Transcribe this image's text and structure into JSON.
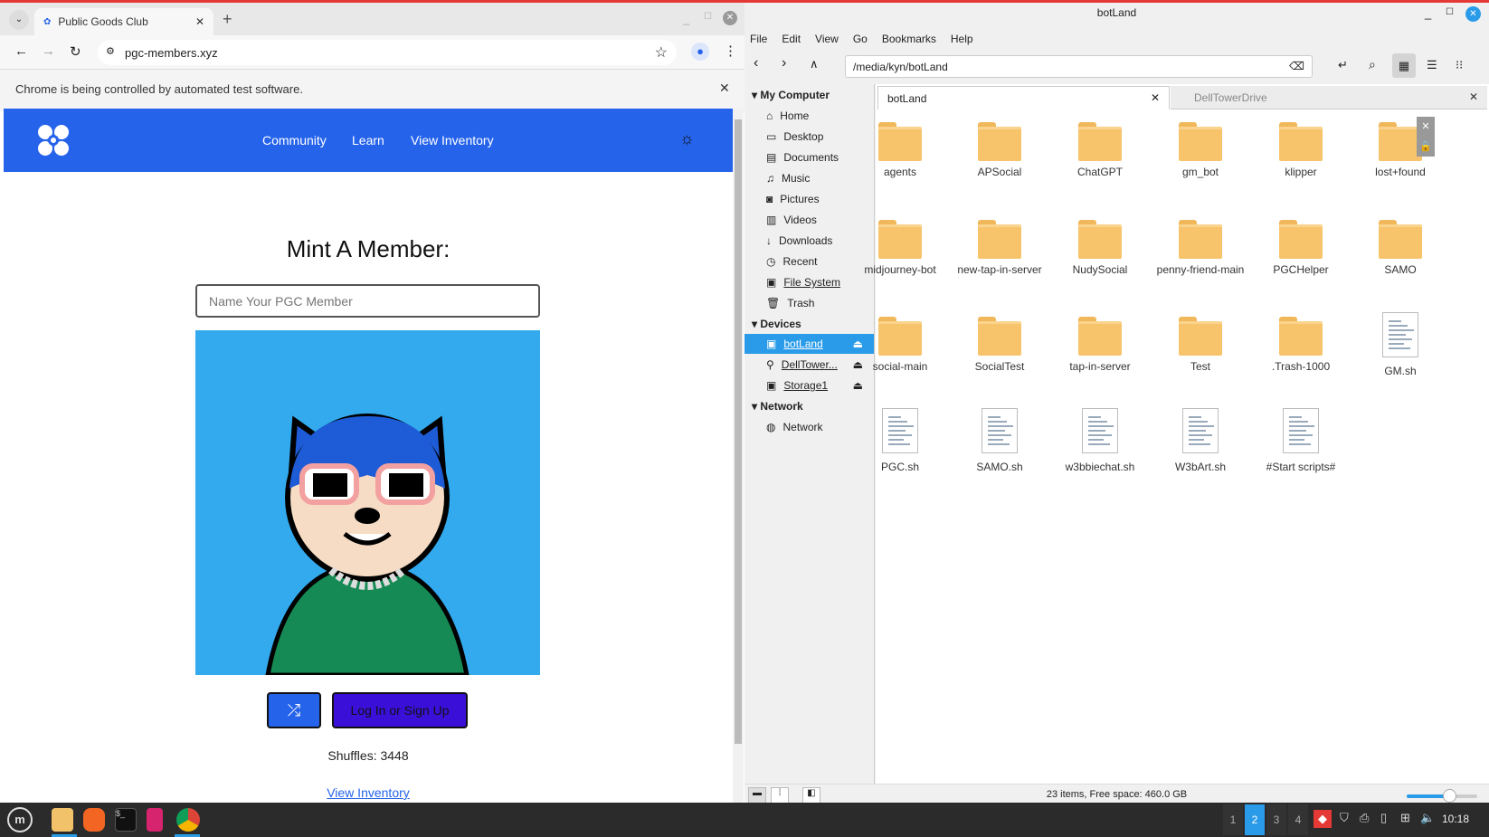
{
  "browser": {
    "tab_title": "Public Goods Club",
    "url": "pgc-members.xyz",
    "infobar": "Chrome is being controlled by automated test software."
  },
  "site": {
    "nav": [
      "Community",
      "Learn",
      "View Inventory"
    ],
    "heading": "Mint A Member:",
    "name_placeholder": "Name Your PGC Member",
    "login_label": "Log In or Sign Up",
    "shuffles": "Shuffles: 3448",
    "inventory_link": "View Inventory",
    "accent": "#2563eb",
    "image_bg": "#33aaee"
  },
  "fm": {
    "title": "botLand",
    "menu": [
      "File",
      "Edit",
      "View",
      "Go",
      "Bookmarks",
      "Help"
    ],
    "path": "/media/kyn/botLand",
    "tabs": [
      "botLand",
      "DellTowerDrive"
    ],
    "sections": {
      "my_computer": "My Computer",
      "devices": "Devices",
      "network": "Network"
    },
    "places": [
      "Home",
      "Desktop",
      "Documents",
      "Music",
      "Pictures",
      "Videos",
      "Downloads",
      "Recent",
      "File System",
      "Trash"
    ],
    "devices": [
      "botLand",
      "DellTower...",
      "Storage1"
    ],
    "network_items": [
      "Network"
    ],
    "items": [
      {
        "name": "agents",
        "type": "folder"
      },
      {
        "name": "APSocial",
        "type": "folder"
      },
      {
        "name": "ChatGPT",
        "type": "folder"
      },
      {
        "name": "gm_bot",
        "type": "folder"
      },
      {
        "name": "klipper",
        "type": "folder"
      },
      {
        "name": "lost+found",
        "type": "folder-locked"
      },
      {
        "name": "midjourney-bot",
        "type": "folder"
      },
      {
        "name": "new-tap-in-server",
        "type": "folder"
      },
      {
        "name": "NudySocial",
        "type": "folder"
      },
      {
        "name": "penny-friend-main",
        "type": "folder"
      },
      {
        "name": "PGCHelper",
        "type": "folder"
      },
      {
        "name": "SAMO",
        "type": "folder"
      },
      {
        "name": "social-main",
        "type": "folder"
      },
      {
        "name": "SocialTest",
        "type": "folder"
      },
      {
        "name": "tap-in-server",
        "type": "folder"
      },
      {
        "name": "Test",
        "type": "folder"
      },
      {
        "name": ".Trash-1000",
        "type": "folder"
      },
      {
        "name": "GM.sh",
        "type": "file"
      },
      {
        "name": "PGC.sh",
        "type": "file"
      },
      {
        "name": "SAMO.sh",
        "type": "file"
      },
      {
        "name": "w3bbiechat.sh",
        "type": "file"
      },
      {
        "name": "W3bArt.sh",
        "type": "file"
      },
      {
        "name": "#Start scripts#",
        "type": "file"
      }
    ],
    "status": "23 items, Free space: 460.0 GB",
    "zoom_level": 0.6
  },
  "taskbar": {
    "workspaces": [
      "1",
      "2",
      "3",
      "4"
    ],
    "active_workspace": "2",
    "clock": "10:18"
  }
}
